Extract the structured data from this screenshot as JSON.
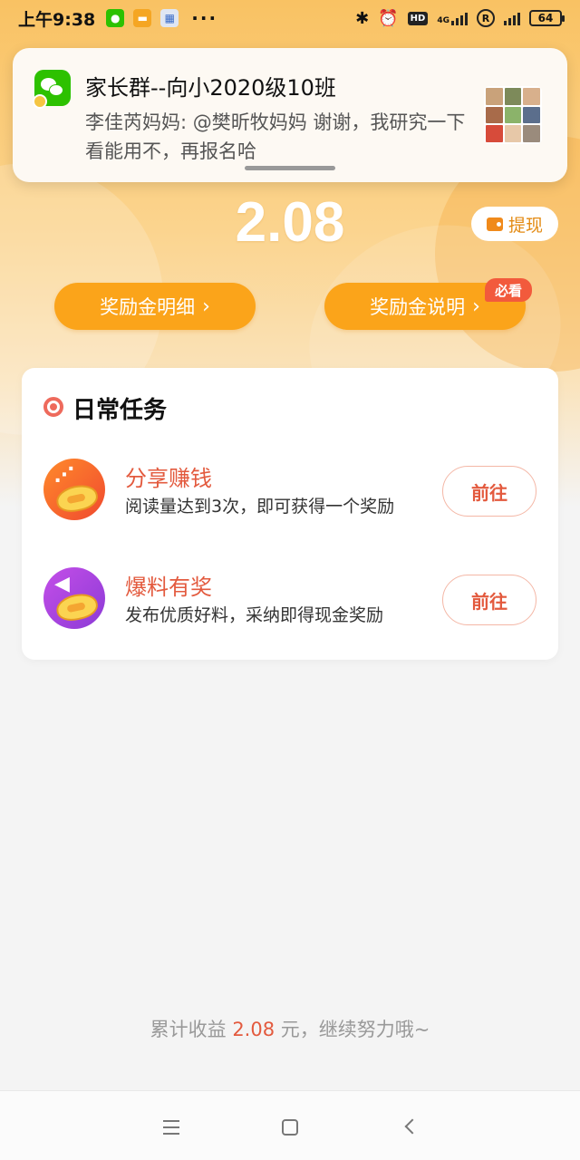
{
  "status_bar": {
    "time": "上午9:38",
    "hd": "HD",
    "network": "4G",
    "battery": "64",
    "more": "···"
  },
  "notification": {
    "title": "家长群--向小2020级10班",
    "body": "李佳芮妈妈: @樊昕牧妈妈 谢谢，我研究一下看能用不，再报名哈",
    "app_icon": "wechat-icon"
  },
  "balance": {
    "amount": "2.08",
    "withdraw_label": "提现"
  },
  "buttons": {
    "detail_label": "奖励金明细",
    "explain_label": "奖励金说明",
    "must_read_badge": "必看",
    "chevron": "›"
  },
  "tasks": {
    "section_title": "日常任务",
    "items": [
      {
        "name": "分享赚钱",
        "desc": "阅读量达到3次，即可获得一个奖励",
        "button": "前往",
        "icon": "share-icon"
      },
      {
        "name": "爆料有奖",
        "desc": "发布优质好料，采纳即得现金奖励",
        "button": "前往",
        "icon": "megaphone-icon"
      }
    ]
  },
  "footer": {
    "prefix": "累计收益 ",
    "amount": "2.08",
    "suffix": " 元，继续努力哦~"
  },
  "colors": {
    "accent": "#fba41a",
    "task_red": "#e35a3e",
    "badge_red": "#f25a3c"
  }
}
